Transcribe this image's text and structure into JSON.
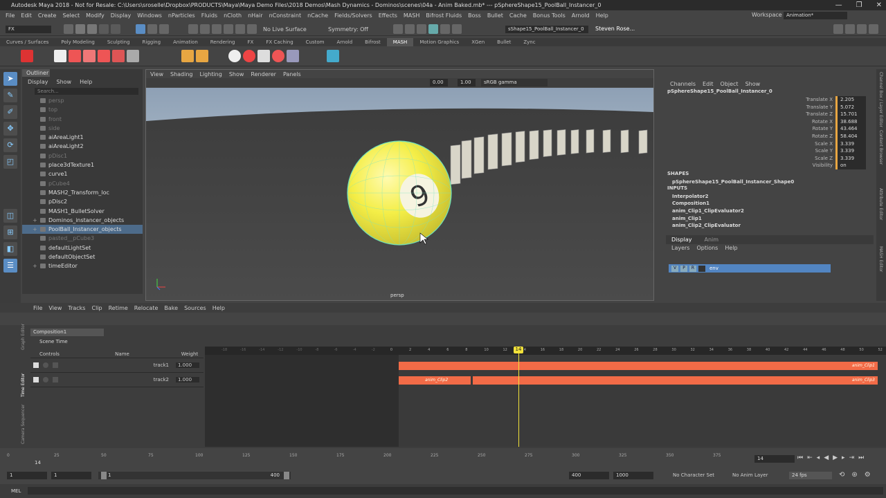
{
  "window": {
    "title": "Autodesk Maya 2018 - Not for Resale: C:\\Users\\sroselle\\Dropbox\\PRODUCTS\\Maya\\Maya Demo Files\\2018 Demos\\Mash Dynamics - Dominos\\scenes\\04a - Anim Baked.mb*  ---  pSphereShape15_PoolBall_Instancer_0",
    "controls": [
      "—",
      "❐",
      "✕"
    ]
  },
  "menubar": {
    "items": [
      "File",
      "Edit",
      "Create",
      "Select",
      "Modify",
      "Display",
      "Windows",
      "nParticles",
      "Fluids",
      "nCloth",
      "nHair",
      "nConstraint",
      "nCache",
      "Fields/Solvers",
      "Effects",
      "MASH",
      "Bifrost Fluids",
      "Boss",
      "Bullet",
      "Cache",
      "Bonus Tools",
      "Arnold",
      "Help"
    ],
    "workspace_label": "Workspace :",
    "workspace_value": "Animation*"
  },
  "statusline": {
    "mode": "FX",
    "live_surface": "No Live Surface",
    "symmetry": "Symmetry: Off",
    "object_field": "sShape15_PoolBall_Instancer_0",
    "user": "Steven Rose..."
  },
  "shelf": {
    "tabs": [
      "Curves / Surfaces",
      "Poly Modeling",
      "Sculpting",
      "Rigging",
      "Animation",
      "Rendering",
      "FX",
      "FX Caching",
      "Custom",
      "Arnold",
      "Bifrost",
      "MASH",
      "Motion Graphics",
      "XGen",
      "Bullet",
      "Zync"
    ],
    "active": "MASH"
  },
  "outliner": {
    "tab": "Outliner",
    "menus": [
      "Display",
      "Show",
      "Help"
    ],
    "search_placeholder": "Search...",
    "items": [
      {
        "label": "persp",
        "dim": true,
        "exp": ""
      },
      {
        "label": "top",
        "dim": true,
        "exp": ""
      },
      {
        "label": "front",
        "dim": true,
        "exp": ""
      },
      {
        "label": "side",
        "dim": true,
        "exp": ""
      },
      {
        "label": "aiAreaLight1",
        "dim": false,
        "exp": ""
      },
      {
        "label": "aiAreaLight2",
        "dim": false,
        "exp": ""
      },
      {
        "label": "pDisc1",
        "dim": true,
        "exp": ""
      },
      {
        "label": "place3dTexture1",
        "dim": false,
        "exp": ""
      },
      {
        "label": "curve1",
        "dim": false,
        "exp": ""
      },
      {
        "label": "pCube4",
        "dim": true,
        "exp": ""
      },
      {
        "label": "MASH2_Transform_loc",
        "dim": false,
        "exp": ""
      },
      {
        "label": "pDisc2",
        "dim": false,
        "exp": ""
      },
      {
        "label": "MASH1_BulletSolver",
        "dim": false,
        "exp": ""
      },
      {
        "label": "Dominos_instancer_objects",
        "dim": false,
        "exp": "+"
      },
      {
        "label": "PoolBall_Instancer_objects",
        "dim": false,
        "exp": "+",
        "sel": true
      },
      {
        "label": "pasted__pCube3",
        "dim": true,
        "exp": ""
      },
      {
        "label": "defaultLightSet",
        "dim": false,
        "exp": ""
      },
      {
        "label": "defaultObjectSet",
        "dim": false,
        "exp": ""
      },
      {
        "label": "timeEditor",
        "dim": false,
        "exp": "+"
      }
    ]
  },
  "viewport": {
    "menus": [
      "View",
      "Shading",
      "Lighting",
      "Show",
      "Renderer",
      "Panels"
    ],
    "exposure": "0.00",
    "gamma": "1.00",
    "colorspace": "sRGB gamma",
    "camera_label": "persp",
    "ball_number": "9"
  },
  "channelbox": {
    "menus": [
      "Channels",
      "Edit",
      "Object",
      "Show"
    ],
    "object": "pSphereShape15_PoolBall_Instancer_0",
    "attributes": [
      {
        "name": "Translate X",
        "value": "2.205"
      },
      {
        "name": "Translate Y",
        "value": "5.072"
      },
      {
        "name": "Translate Z",
        "value": "15.701"
      },
      {
        "name": "Rotate X",
        "value": "38.688"
      },
      {
        "name": "Rotate Y",
        "value": "43.464"
      },
      {
        "name": "Rotate Z",
        "value": "58.404"
      },
      {
        "name": "Scale X",
        "value": "3.339"
      },
      {
        "name": "Scale Y",
        "value": "3.339"
      },
      {
        "name": "Scale Z",
        "value": "3.339"
      },
      {
        "name": "Visibility",
        "value": "on"
      }
    ],
    "shapes_header": "SHAPES",
    "shape": "pSphereShape15_PoolBall_Instancer_Shape0",
    "inputs_header": "INPUTS",
    "inputs": [
      "Interpolator2",
      "Composition1",
      "anim_Clip1_ClipEvaluator2",
      "anim_Clip1",
      "anim_Clip2_ClipEvaluator"
    ],
    "layer_tabs": [
      "Display",
      "Anim"
    ],
    "layer_menus": [
      "Layers",
      "Options",
      "Help"
    ],
    "layer_flags": [
      "V",
      "P",
      "R"
    ],
    "layer_name": "env"
  },
  "right_strip": [
    "Channel Box / Layer Editor",
    "Content Browser",
    "Attribute Editor",
    "MASH Editor"
  ],
  "time_editor": {
    "side_tabs": [
      "Graph Editor",
      "Time Editor",
      "Camera Sequencer"
    ],
    "menus": [
      "File",
      "View",
      "Tracks",
      "Clip",
      "Retime",
      "Relocate",
      "Bake",
      "Sources",
      "Help"
    ],
    "composition": "Composition1",
    "scene_time": "Scene Time",
    "headers": [
      "Controls",
      "Name",
      "Weight"
    ],
    "tracks": [
      {
        "name": "track1",
        "weight": "1.000"
      },
      {
        "name": "track2",
        "weight": "1.000"
      }
    ],
    "ruler_ticks": [
      "-18",
      "-16",
      "-14",
      "-12",
      "-10",
      "-8",
      "-6",
      "-4",
      "-2",
      "0",
      "2",
      "4",
      "6",
      "8",
      "10",
      "12",
      "14",
      "16",
      "18",
      "20",
      "22",
      "24",
      "26",
      "28",
      "30",
      "32",
      "34",
      "36",
      "38",
      "40",
      "42",
      "44",
      "46",
      "48",
      "50",
      "52"
    ],
    "current_frame": "14",
    "clips": {
      "c1": "anim_Clip1",
      "c2": "anim_Clip2",
      "c3": "anim_Clip3"
    }
  },
  "range": {
    "ticks": [
      "0",
      "25",
      "50",
      "75",
      "100",
      "125",
      "150",
      "175",
      "200",
      "225",
      "250",
      "275",
      "300",
      "325",
      "350",
      "375"
    ],
    "current": "14",
    "frame_field": "14"
  },
  "rangeslider": {
    "start": "1",
    "start2": "1",
    "slider_start": "1",
    "slider_end": "400",
    "end": "400",
    "end2": "1000",
    "char_set": "No Character Set",
    "anim_layer": "No Anim Layer",
    "fps": "24 fps"
  },
  "mel": {
    "label": "MEL"
  },
  "colors": {
    "accent": "#5285c2",
    "clip": "#f26b47",
    "playhead": "#f2e23a",
    "ball": "#f4ee47"
  }
}
